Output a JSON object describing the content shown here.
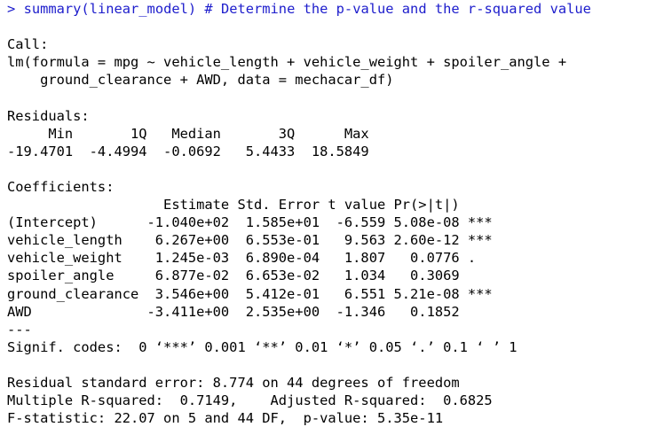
{
  "console": {
    "prompt": ">",
    "command": "summary(linear_model) # Determine the p-value and the r-squared value",
    "output_lines": [
      "",
      "Call:",
      "lm(formula = mpg ~ vehicle_length + vehicle_weight + spoiler_angle +",
      "    ground_clearance + AWD, data = mechacar_df)",
      "",
      "Residuals:",
      "     Min       1Q   Median       3Q      Max ",
      "-19.4701  -4.4994  -0.0692   5.4433  18.5849 ",
      "",
      "Coefficients:",
      "                   Estimate Std. Error t value Pr(>|t|)    ",
      "(Intercept)      -1.040e+02  1.585e+01  -6.559 5.08e-08 ***",
      "vehicle_length    6.267e+00  6.553e-01   9.563 2.60e-12 ***",
      "vehicle_weight    1.245e-03  6.890e-04   1.807   0.0776 .  ",
      "spoiler_angle     6.877e-02  6.653e-02   1.034   0.3069    ",
      "ground_clearance  3.546e+00  5.412e-01   6.551 5.21e-08 ***",
      "AWD              -3.411e+00  2.535e+00  -1.346   0.1852    ",
      "---",
      "Signif. codes:  0 ‘***’ 0.001 ‘**’ 0.01 ‘*’ 0.05 ‘.’ 0.1 ‘ ’ 1",
      "",
      "Residual standard error: 8.774 on 44 degrees of freedom",
      "Multiple R-squared:  0.7149,\tAdjusted R-squared:  0.6825 ",
      "F-statistic: 22.07 on 5 and 44 DF,  p-value: 5.35e-11"
    ]
  },
  "colors": {
    "command": "#1d1dcc",
    "output": "#000000",
    "background": "#ffffff"
  }
}
